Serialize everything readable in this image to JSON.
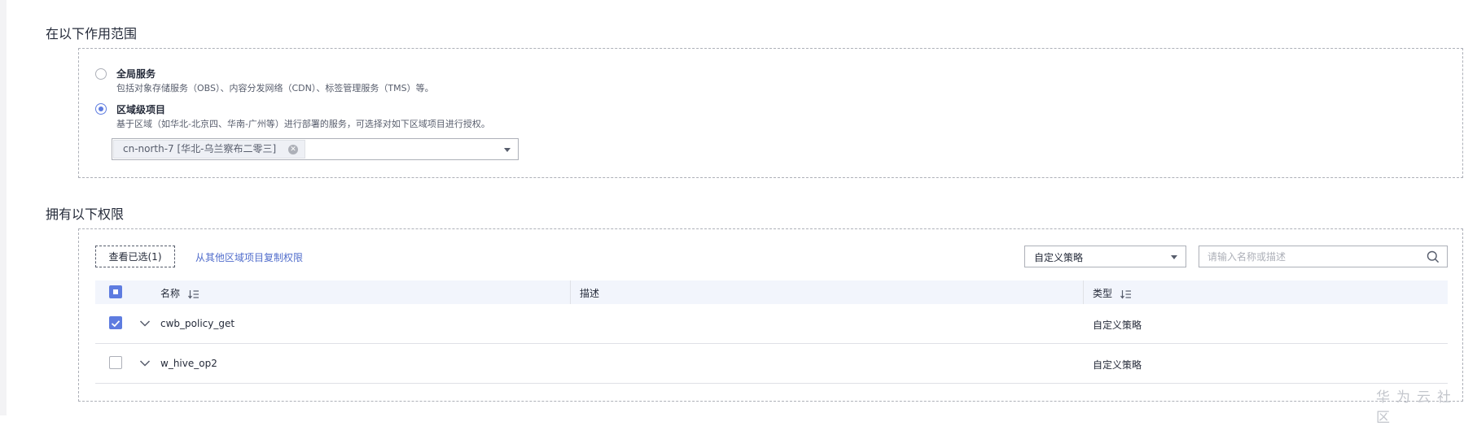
{
  "scope": {
    "title": "在以下作用范围",
    "global_option": {
      "title": "全局服务",
      "description": "包括对象存储服务（OBS）、内容分发网络（CDN）、标签管理服务（TMS）等。",
      "selected": false
    },
    "region_option": {
      "title": "区域级项目",
      "description": "基于区域（如华北-北京四、华南-广州等）进行部署的服务，可选择对如下区域项目进行授权。",
      "selected": true
    },
    "region_select": {
      "selected_tag": "cn-north-7 [华北-乌兰察布二零三]",
      "tag_close_icon": "close-circle-icon",
      "caret_icon": "caret-down-icon"
    }
  },
  "permissions": {
    "title": "拥有以下权限",
    "view_selected_label": "查看已选(1)",
    "copy_link_label": "从其他区域项目复制权限",
    "policy_type_select": {
      "value": "自定义策略",
      "caret_icon": "caret-down-icon"
    },
    "search": {
      "placeholder": "请输入名称或描述",
      "value": "",
      "icon": "search-icon"
    },
    "table": {
      "headers": {
        "name": "名称",
        "description": "描述",
        "type": "类型"
      },
      "header_checkbox_state": "partial",
      "rows": [
        {
          "checked": true,
          "name": "cwb_policy_get",
          "description": "",
          "type": "自定义策略"
        },
        {
          "checked": false,
          "name": "w_hive_op2",
          "description": "",
          "type": "自定义策略"
        }
      ]
    }
  },
  "watermark": "华为云社区",
  "colors": {
    "accent": "#5e7ce0",
    "link": "#526ecc",
    "header_bg": "#f2f5fc",
    "border": "#adb0b8"
  }
}
